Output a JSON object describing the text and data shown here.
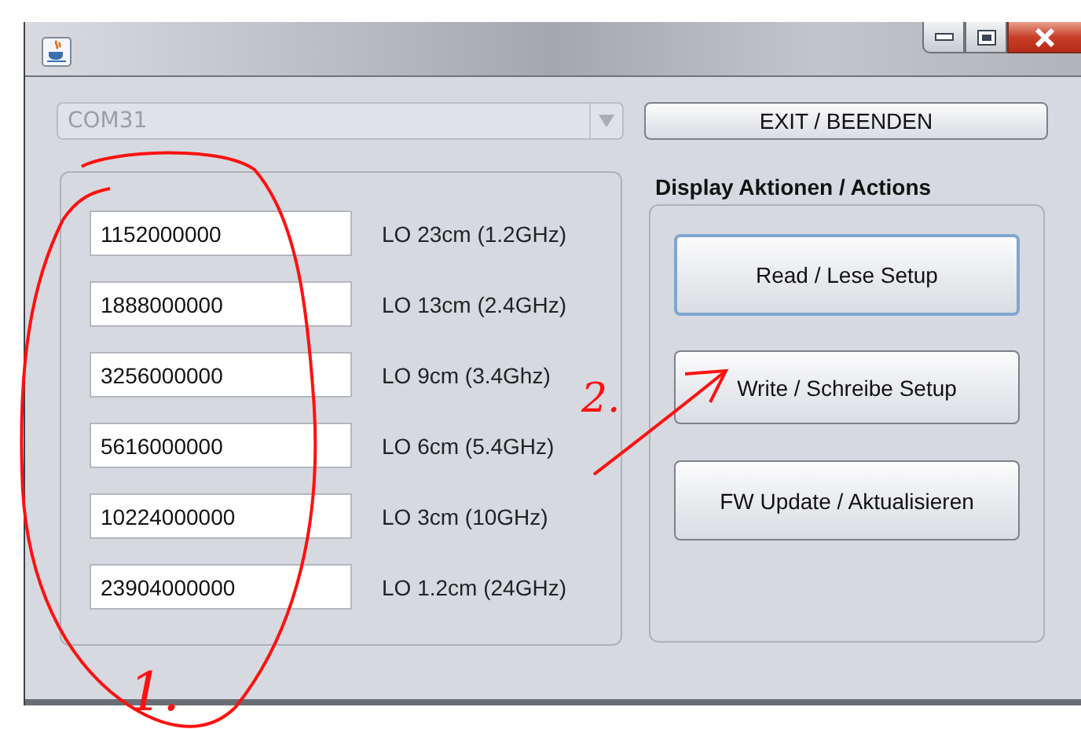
{
  "port_select": {
    "value": "COM31",
    "disabled": true
  },
  "exit_button": {
    "label": "EXIT / BEENDEN"
  },
  "lo_rows": [
    {
      "value": "1152000000",
      "label": "LO 23cm (1.2GHz)"
    },
    {
      "value": "1888000000",
      "label": "LO 13cm (2.4GHz)"
    },
    {
      "value": "3256000000",
      "label": "LO 9cm (3.4Ghz)"
    },
    {
      "value": "5616000000",
      "label": "LO 6cm (5.4GHz)"
    },
    {
      "value": "10224000000",
      "label": "LO 3cm (10GHz)"
    },
    {
      "value": "23904000000",
      "label": "LO 1.2cm (24GHz)"
    }
  ],
  "actions": {
    "title": "Display Aktionen / Actions",
    "buttons": [
      {
        "label": "Read / Lese Setup",
        "focused": true
      },
      {
        "label": "Write / Schreibe Setup",
        "focused": false
      },
      {
        "label": "FW Update / Aktualisieren",
        "focused": false
      }
    ]
  },
  "annotations": {
    "labels": [
      "1.",
      "2."
    ]
  }
}
